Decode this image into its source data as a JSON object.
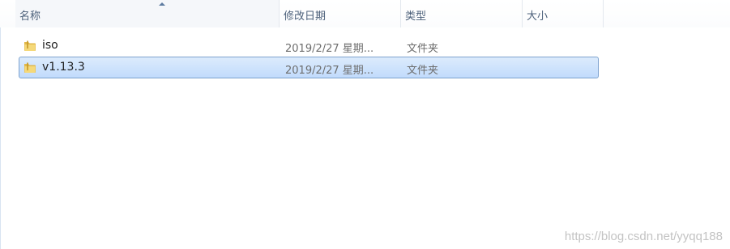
{
  "columns": {
    "name": "名称",
    "date_modified": "修改日期",
    "type": "类型",
    "size": "大小",
    "sort_column": "name",
    "sort_direction": "ascending"
  },
  "files": [
    {
      "icon": "folder-icon",
      "name": "iso",
      "date_modified": "2019/2/27 星期...",
      "type": "文件夹",
      "size": "",
      "selected": false
    },
    {
      "icon": "folder-icon",
      "name": "v1.13.3",
      "date_modified": "2019/2/27 星期...",
      "type": "文件夹",
      "size": "",
      "selected": true
    }
  ],
  "colors": {
    "selection_fill": "#cce1fc",
    "selection_border": "#7da2ce",
    "header_text": "#4c607a",
    "folder": "#e8c35a"
  },
  "watermark": "https://blog.csdn.net/yyqq188"
}
